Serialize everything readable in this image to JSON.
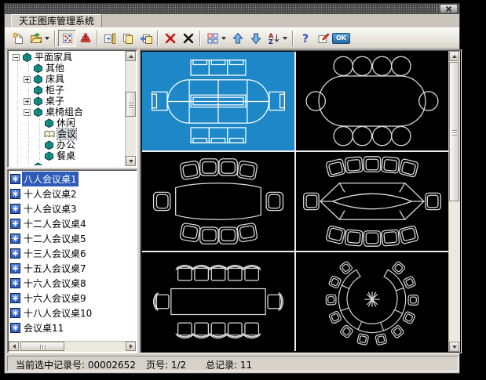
{
  "window": {
    "title": "天正图库管理系统"
  },
  "toolbar": {
    "ok_label": "OK",
    "sort_a": "A",
    "sort_z": "Z",
    "help_glyph": "?",
    "icons": [
      "new-icon",
      "open-folder-icon",
      "open-dropdown-caret",
      "thumbnail-view-icon",
      "pyramid-view-icon",
      "batch-import-icon",
      "copy-record-icon",
      "move-record-icon",
      "delete-icon",
      "delete-all-icon",
      "layout-grid-icon",
      "layout-dropdown-caret",
      "move-up-icon",
      "move-down-icon",
      "sort-az-icon",
      "sort-dropdown-caret",
      "help-icon",
      "rename-icon",
      "ok-button"
    ]
  },
  "tree": {
    "items": [
      {
        "label": "平面家具",
        "level": 1,
        "toggle": "minus",
        "icon": "book"
      },
      {
        "label": "其他",
        "level": 2,
        "toggle": "none",
        "icon": "book"
      },
      {
        "label": "床具",
        "level": 2,
        "toggle": "plus",
        "icon": "book"
      },
      {
        "label": "柜子",
        "level": 2,
        "toggle": "none",
        "icon": "book"
      },
      {
        "label": "桌子",
        "level": 2,
        "toggle": "plus",
        "icon": "book"
      },
      {
        "label": "桌椅组合",
        "level": 2,
        "toggle": "minus",
        "icon": "book"
      },
      {
        "label": "休闲",
        "level": 3,
        "toggle": "none",
        "icon": "book"
      },
      {
        "label": "会议",
        "level": 3,
        "toggle": "none",
        "icon": "book-open",
        "selected": true
      },
      {
        "label": "办公",
        "level": 3,
        "toggle": "none",
        "icon": "book"
      },
      {
        "label": "餐桌",
        "level": 3,
        "toggle": "none",
        "icon": "book"
      },
      {
        "label": "",
        "level": 2,
        "toggle": "none",
        "icon": "book",
        "partial": true
      }
    ]
  },
  "file_list": {
    "items": [
      {
        "label": "八人会议桌1",
        "selected": true
      },
      {
        "label": "十人会议桌2"
      },
      {
        "label": "十人会议桌3"
      },
      {
        "label": "十二人会议桌4"
      },
      {
        "label": "十二人会议桌5"
      },
      {
        "label": "十三人会议桌6"
      },
      {
        "label": "十五人会议桌7"
      },
      {
        "label": "十六人会议桌8"
      },
      {
        "label": "十六人会议桌9"
      },
      {
        "label": "十八人会议桌10"
      },
      {
        "label": "会议桌11"
      }
    ]
  },
  "thumbnails": {
    "visible_count": 6,
    "selected_index": 0
  },
  "status_bar": {
    "record_label": "当前选中记录号:",
    "record_value": "00002652",
    "page_label": "页号:",
    "page_value": "1/2",
    "total_label": "总记录:",
    "total_value": "11"
  },
  "colors": {
    "selection_blue": "#2e5bb7",
    "thumb_selected_bg": "#1d87c7",
    "thumb_bg": "#000000",
    "drawing_stroke": "#dcdcdc",
    "book_teal": "#15938a"
  }
}
